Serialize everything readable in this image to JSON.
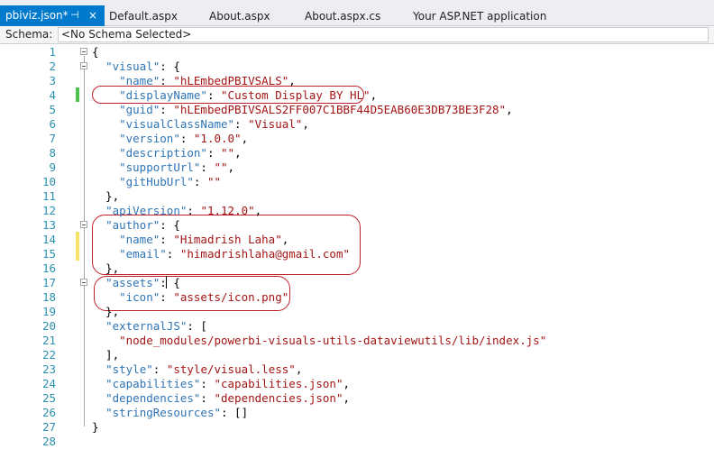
{
  "tabs": [
    {
      "label": "pbiviz.json*",
      "active": true,
      "pin": "⊣",
      "close": "×"
    },
    {
      "label": "Default.aspx",
      "active": false
    },
    {
      "label": "About.aspx",
      "active": false
    },
    {
      "label": "About.aspx.cs",
      "active": false
    },
    {
      "label": "Your ASP.NET application",
      "active": false
    }
  ],
  "schema": {
    "label": "Schema:",
    "value": "<No Schema Selected>"
  },
  "colors": {
    "accent": "#007acc",
    "line_number": "#2b91af",
    "json_key": "#2e75b6",
    "json_string": "#a31515",
    "annotation": "#c0202a",
    "saved_change": "#4fc14f",
    "unsaved_change": "#f3e26b"
  },
  "lines": [
    {
      "n": "1",
      "parts": [
        {
          "c": "p",
          "t": "{"
        }
      ]
    },
    {
      "n": "2",
      "parts": [
        {
          "c": "p",
          "t": "  "
        },
        {
          "c": "k",
          "t": "\"visual\""
        },
        {
          "c": "p",
          "t": ": {"
        }
      ]
    },
    {
      "n": "3",
      "parts": [
        {
          "c": "p",
          "t": "    "
        },
        {
          "c": "k",
          "t": "\"name\""
        },
        {
          "c": "p",
          "t": ": "
        },
        {
          "c": "s",
          "t": "\"hLEmbedPBIVSALS\""
        },
        {
          "c": "p",
          "t": ","
        }
      ]
    },
    {
      "n": "4",
      "parts": [
        {
          "c": "p",
          "t": "    "
        },
        {
          "c": "k",
          "t": "\"displayName\""
        },
        {
          "c": "p",
          "t": ": "
        },
        {
          "c": "s",
          "t": "\"Custom Display BY HL\""
        },
        {
          "c": "p",
          "t": ","
        }
      ]
    },
    {
      "n": "5",
      "parts": [
        {
          "c": "p",
          "t": "    "
        },
        {
          "c": "k",
          "t": "\"guid\""
        },
        {
          "c": "p",
          "t": ": "
        },
        {
          "c": "s",
          "t": "\"hLEmbedPBIVSALS2FF007C1BBF44D5EAB60E3DB73BE3F28\""
        },
        {
          "c": "p",
          "t": ","
        }
      ]
    },
    {
      "n": "6",
      "parts": [
        {
          "c": "p",
          "t": "    "
        },
        {
          "c": "k",
          "t": "\"visualClassName\""
        },
        {
          "c": "p",
          "t": ": "
        },
        {
          "c": "s",
          "t": "\"Visual\""
        },
        {
          "c": "p",
          "t": ","
        }
      ]
    },
    {
      "n": "7",
      "parts": [
        {
          "c": "p",
          "t": "    "
        },
        {
          "c": "k",
          "t": "\"version\""
        },
        {
          "c": "p",
          "t": ": "
        },
        {
          "c": "s",
          "t": "\"1.0.0\""
        },
        {
          "c": "p",
          "t": ","
        }
      ]
    },
    {
      "n": "8",
      "parts": [
        {
          "c": "p",
          "t": "    "
        },
        {
          "c": "k",
          "t": "\"description\""
        },
        {
          "c": "p",
          "t": ": "
        },
        {
          "c": "s",
          "t": "\"\""
        },
        {
          "c": "p",
          "t": ","
        }
      ]
    },
    {
      "n": "9",
      "parts": [
        {
          "c": "p",
          "t": "    "
        },
        {
          "c": "k",
          "t": "\"supportUrl\""
        },
        {
          "c": "p",
          "t": ": "
        },
        {
          "c": "s",
          "t": "\"\""
        },
        {
          "c": "p",
          "t": ","
        }
      ]
    },
    {
      "n": "10",
      "parts": [
        {
          "c": "p",
          "t": "    "
        },
        {
          "c": "k",
          "t": "\"gitHubUrl\""
        },
        {
          "c": "p",
          "t": ": "
        },
        {
          "c": "s",
          "t": "\"\""
        }
      ]
    },
    {
      "n": "11",
      "parts": [
        {
          "c": "p",
          "t": "  },"
        }
      ]
    },
    {
      "n": "12",
      "parts": [
        {
          "c": "p",
          "t": "  "
        },
        {
          "c": "k",
          "t": "\"apiVersion\""
        },
        {
          "c": "p",
          "t": ": "
        },
        {
          "c": "s",
          "t": "\"1.12.0\""
        },
        {
          "c": "p",
          "t": ","
        }
      ]
    },
    {
      "n": "13",
      "parts": [
        {
          "c": "p",
          "t": "  "
        },
        {
          "c": "k",
          "t": "\"author\""
        },
        {
          "c": "p",
          "t": ": {"
        }
      ]
    },
    {
      "n": "14",
      "parts": [
        {
          "c": "p",
          "t": "    "
        },
        {
          "c": "k",
          "t": "\"name\""
        },
        {
          "c": "p",
          "t": ": "
        },
        {
          "c": "s",
          "t": "\"Himadrish Laha\""
        },
        {
          "c": "p",
          "t": ","
        }
      ]
    },
    {
      "n": "15",
      "parts": [
        {
          "c": "p",
          "t": "    "
        },
        {
          "c": "k",
          "t": "\"email\""
        },
        {
          "c": "p",
          "t": ": "
        },
        {
          "c": "s",
          "t": "\"himadrishlaha@gmail.com\""
        }
      ]
    },
    {
      "n": "16",
      "parts": [
        {
          "c": "p",
          "t": "  },"
        }
      ]
    },
    {
      "n": "17",
      "parts": [
        {
          "c": "p",
          "t": "  "
        },
        {
          "c": "k",
          "t": "\"assets\""
        },
        {
          "c": "p",
          "t": ": {"
        }
      ]
    },
    {
      "n": "18",
      "parts": [
        {
          "c": "p",
          "t": "    "
        },
        {
          "c": "k",
          "t": "\"icon\""
        },
        {
          "c": "p",
          "t": ": "
        },
        {
          "c": "s",
          "t": "\"assets/icon.png\""
        }
      ]
    },
    {
      "n": "19",
      "parts": [
        {
          "c": "p",
          "t": "  },"
        }
      ]
    },
    {
      "n": "20",
      "parts": [
        {
          "c": "p",
          "t": "  "
        },
        {
          "c": "k",
          "t": "\"externalJS\""
        },
        {
          "c": "p",
          "t": ": ["
        }
      ]
    },
    {
      "n": "21",
      "parts": [
        {
          "c": "p",
          "t": "    "
        },
        {
          "c": "s",
          "t": "\"node_modules/powerbi-visuals-utils-dataviewutils/lib/index.js\""
        }
      ]
    },
    {
      "n": "22",
      "parts": [
        {
          "c": "p",
          "t": "  ],"
        }
      ]
    },
    {
      "n": "23",
      "parts": [
        {
          "c": "p",
          "t": "  "
        },
        {
          "c": "k",
          "t": "\"style\""
        },
        {
          "c": "p",
          "t": ": "
        },
        {
          "c": "s",
          "t": "\"style/visual.less\""
        },
        {
          "c": "p",
          "t": ","
        }
      ]
    },
    {
      "n": "24",
      "parts": [
        {
          "c": "p",
          "t": "  "
        },
        {
          "c": "k",
          "t": "\"capabilities\""
        },
        {
          "c": "p",
          "t": ": "
        },
        {
          "c": "s",
          "t": "\"capabilities.json\""
        },
        {
          "c": "p",
          "t": ","
        }
      ]
    },
    {
      "n": "25",
      "parts": [
        {
          "c": "p",
          "t": "  "
        },
        {
          "c": "k",
          "t": "\"dependencies\""
        },
        {
          "c": "p",
          "t": ": "
        },
        {
          "c": "s",
          "t": "\"dependencies.json\""
        },
        {
          "c": "p",
          "t": ","
        }
      ]
    },
    {
      "n": "26",
      "parts": [
        {
          "c": "p",
          "t": "  "
        },
        {
          "c": "k",
          "t": "\"stringResources\""
        },
        {
          "c": "p",
          "t": ": []"
        }
      ]
    },
    {
      "n": "27",
      "parts": [
        {
          "c": "p",
          "t": "}"
        }
      ]
    },
    {
      "n": "28",
      "parts": []
    }
  ]
}
